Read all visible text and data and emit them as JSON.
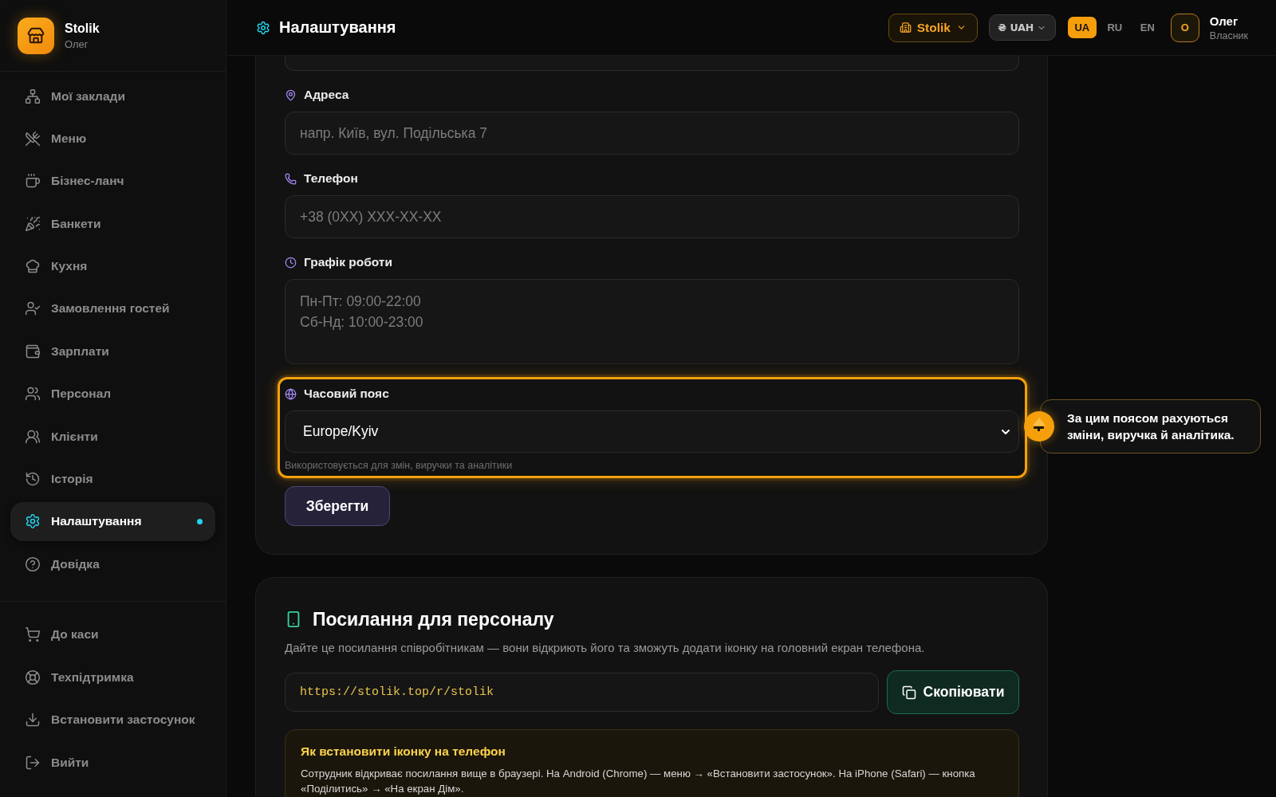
{
  "sidebar": {
    "brand": {
      "name": "Stolik",
      "subtitle": "Олег"
    },
    "nav_items": [
      {
        "label": "Мої заклади",
        "selected": false
      },
      {
        "label": "Меню",
        "selected": false
      },
      {
        "label": "Бізнес-ланч",
        "selected": false
      },
      {
        "label": "Банкети",
        "selected": false
      },
      {
        "label": "Кухня",
        "selected": false
      },
      {
        "label": "Замовлення гостей",
        "selected": false
      },
      {
        "label": "Зарплати",
        "selected": false
      },
      {
        "label": "Персонал",
        "selected": false
      },
      {
        "label": "Клієнти",
        "selected": false
      },
      {
        "label": "Історія",
        "selected": false
      },
      {
        "label": "Налаштування",
        "selected": true
      },
      {
        "label": "Довідка",
        "selected": false
      }
    ],
    "bottom_items": [
      {
        "label": "До каси"
      },
      {
        "label": "Техпідтримка"
      },
      {
        "label": "Встановити застосунок"
      },
      {
        "label": "Вийти"
      }
    ]
  },
  "header": {
    "title": "Налаштування",
    "venue_button": "Stolik",
    "currency_button": "₴ UAH",
    "languages": [
      {
        "label": "UA",
        "selected": true
      },
      {
        "label": "RU",
        "selected": false
      },
      {
        "label": "EN",
        "selected": false
      }
    ],
    "user": {
      "initial": "О",
      "name": "Олег",
      "role": "Власник"
    }
  },
  "settings_form": {
    "fields": [
      {
        "kind": "input",
        "label": "Адреса",
        "placeholder": "напр. Київ, вул. Подільська 7",
        "highlighted": false
      },
      {
        "kind": "input",
        "label": "Телефон",
        "placeholder": "+38 (0XX) XXX-XX-XX",
        "highlighted": false
      },
      {
        "kind": "textarea",
        "label": "Графік роботи",
        "placeholder": "Пн-Пт: 09:00-22:00\nСб-Нд: 10:00-23:00",
        "highlighted": false
      },
      {
        "kind": "select",
        "label": "Часовий пояс",
        "value": "Europe/Kyiv",
        "hint": "Використовується для змін, виручки та аналітики",
        "highlighted": true
      }
    ],
    "save_button": "Зберегти"
  },
  "tour_tooltip": {
    "text": "За цим поясом рахуються зміни, виручка й аналітика."
  },
  "staff_link_card": {
    "title": "Посилання для персоналу",
    "description": "Дайте це посилання співробітникам — вони відкриють його та зможуть додати іконку на головний екран телефона.",
    "url": "https://stolik.top/r/stolik",
    "copy_button": "Скопіювати",
    "install_info": {
      "title": "Як встановити іконку на телефон",
      "text": "Сотрудник відкриває посилання вище в браузері. На Android (Chrome) — меню → «Встановити застосунок». На iPhone (Safari) — кнопка «Поділитись» → «На екран Дім»."
    }
  }
}
